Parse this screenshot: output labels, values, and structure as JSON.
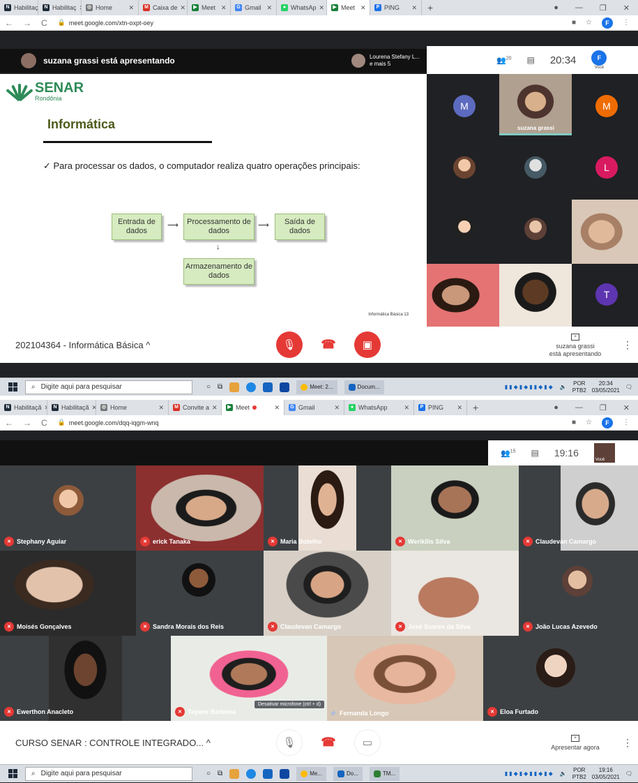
{
  "shot1": {
    "tabs": [
      {
        "label": "Habilitaç",
        "fav_color": "#1e2a38",
        "fav_text": "N"
      },
      {
        "label": "Habilitaç",
        "fav_color": "#1e2a38",
        "fav_text": "N"
      },
      {
        "label": "Home",
        "fav_color": "#777777",
        "fav_text": "◎"
      },
      {
        "label": "Caixa de",
        "fav_color": "#d93025",
        "fav_text": "M"
      },
      {
        "label": "Meet",
        "fav_color": "#188038",
        "fav_text": "▶",
        "recording": true
      },
      {
        "label": "Gmail",
        "fav_color": "#4285f4",
        "fav_text": "G"
      },
      {
        "label": "WhatsAp",
        "fav_color": "#25d366",
        "fav_text": "●"
      },
      {
        "label": "Meet",
        "fav_color": "#188038",
        "fav_text": "▶",
        "recording": true,
        "active": true
      },
      {
        "label": "PING",
        "fav_color": "#1a73e8",
        "fav_text": "P"
      }
    ],
    "url": "meet.google.com/xtn-oxpt-oey",
    "presenting_banner": "suzana grassi está apresentando",
    "top_user": {
      "line1": "Lourena Stefany L...",
      "line2": "e mais 5"
    },
    "people_count": "20",
    "time": "20:34",
    "you_label": "Você",
    "slide": {
      "brand": "SENAR",
      "brand_sub": "Rondônia",
      "title": "Informática",
      "bullet": "✓ Para processar os dados, o computador realiza quatro operações principais:",
      "boxes": [
        "Entrada de dados",
        "Processamento de dados",
        "Saída de dados",
        "Armazenamento de dados"
      ],
      "footer": "Informática Básica   13"
    },
    "participants": [
      {
        "letter": "M",
        "color": "#5c6bc0"
      },
      {
        "name": "suzana grassi"
      },
      {
        "letter": "M",
        "color": "#ef6c00"
      },
      {
        "letter": "L",
        "color": "#d81b60"
      },
      {
        "letter": "T",
        "color": "#5e35b1"
      }
    ],
    "meeting_name": "202104364 - Informática Básica",
    "presenter_status": {
      "line1": "suzana grassi",
      "line2": "está apresentando"
    },
    "taskbar": {
      "search": "Digite aqui para pesquisar",
      "app1": "Meet: 2...",
      "app2": "Docum...",
      "lang1": "POR",
      "lang2": "PTB2",
      "clock_time": "20:34",
      "clock_date": "03/05/2021"
    }
  },
  "shot2": {
    "tabs": [
      {
        "label": "Habilitaçã",
        "fav_color": "#1e2a38",
        "fav_text": "N"
      },
      {
        "label": "Habilitaçã",
        "fav_color": "#1e2a38",
        "fav_text": "N"
      },
      {
        "label": "Home",
        "fav_color": "#777777",
        "fav_text": "◎"
      },
      {
        "label": "Convite a",
        "fav_color": "#d93025",
        "fav_text": "M"
      },
      {
        "label": "Meet",
        "fav_color": "#188038",
        "fav_text": "▶",
        "recording": true,
        "active": true
      },
      {
        "label": "Gmail",
        "fav_color": "#4285f4",
        "fav_text": "G"
      },
      {
        "label": "WhatsApp",
        "fav_color": "#25d366",
        "fav_text": "●"
      },
      {
        "label": "PING",
        "fav_color": "#1a73e8",
        "fav_text": "P"
      }
    ],
    "url": "meet.google.com/dqq-iqgm-wnq",
    "people_count": "15",
    "time": "19:16",
    "you_label": "Você",
    "tiles": [
      {
        "name": "Stephany Aguiar",
        "muted": true
      },
      {
        "name": "erick Tanaka",
        "muted": true
      },
      {
        "name": "Maria Botelho",
        "muted": true
      },
      {
        "name": "Werikllis Silva",
        "muted": true
      },
      {
        "name": "Claudevan Camargo",
        "muted": true
      },
      {
        "name": "Moisés Gonçalves",
        "muted": true
      },
      {
        "name": "Sandra Morais dos Reis",
        "muted": true
      },
      {
        "name": "Claudevan Camargo",
        "muted": true
      },
      {
        "name": "José Soares da Silva",
        "muted": true
      },
      {
        "name": "João Lucas Azevedo",
        "muted": true
      },
      {
        "name": "Ewerthon Anacleto",
        "muted": true
      },
      {
        "name": "Tayane Barbosa",
        "muted": true
      },
      {
        "name": "Fernanda Longo",
        "muted": false
      },
      {
        "name": "Eloa Furtado",
        "muted": true
      }
    ],
    "tooltip": "Desativar microfone (ctrl + d)",
    "meeting_name": "CURSO SENAR : CONTROLE INTEGRADO...",
    "present_label": "Apresentar agora",
    "taskbar": {
      "search": "Digite aqui para pesquisar",
      "app1": "Me...",
      "app2": "Do...",
      "app3": "TM...",
      "lang1": "POR",
      "lang2": "PTB2",
      "clock_time": "19:16",
      "clock_date": "03/05/2021"
    }
  }
}
